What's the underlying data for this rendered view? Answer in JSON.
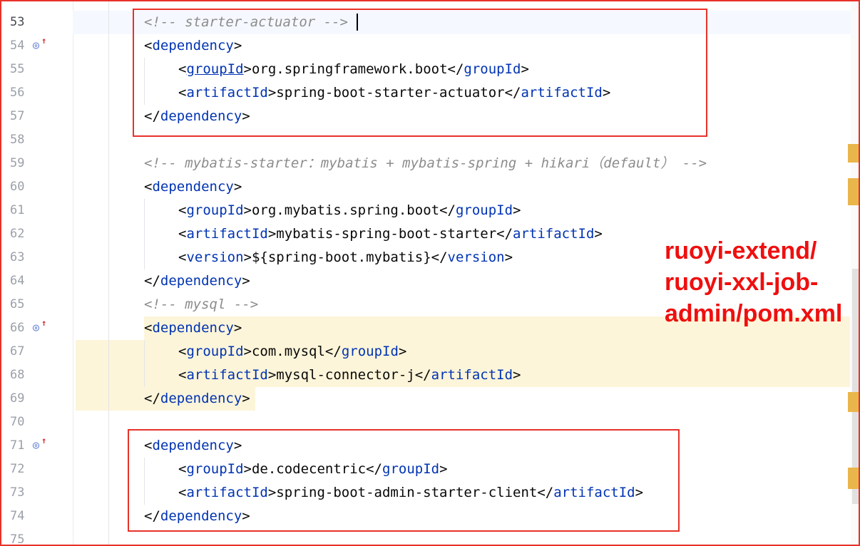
{
  "editor": {
    "file_annotation": "ruoyi-extend/\nruoyi-xxl-job-\nadmin/pom.xml",
    "lines": [
      {
        "num": "53",
        "tokens": [
          {
            "t": "<!-- starter-actuator -->",
            "c": "cm"
          }
        ]
      },
      {
        "num": "54",
        "tokens": [
          {
            "t": "<",
            "c": "p"
          },
          {
            "t": "dependency",
            "c": "tg"
          },
          {
            "t": ">",
            "c": "p"
          }
        ]
      },
      {
        "num": "55",
        "tokens": [
          {
            "t": "<",
            "c": "p"
          },
          {
            "t": "groupId",
            "c": "tg u"
          },
          {
            "t": ">org.springframework.boot</",
            "c": "p"
          },
          {
            "t": "groupId",
            "c": "tg"
          },
          {
            "t": ">",
            "c": "p"
          }
        ]
      },
      {
        "num": "56",
        "tokens": [
          {
            "t": "<",
            "c": "p"
          },
          {
            "t": "artifactId",
            "c": "tg"
          },
          {
            "t": ">spring-boot-starter-actuator</",
            "c": "p"
          },
          {
            "t": "artifactId",
            "c": "tg"
          },
          {
            "t": ">",
            "c": "p"
          }
        ]
      },
      {
        "num": "57",
        "tokens": [
          {
            "t": "</",
            "c": "p"
          },
          {
            "t": "dependency",
            "c": "tg"
          },
          {
            "t": ">",
            "c": "p"
          }
        ]
      },
      {
        "num": "58",
        "tokens": []
      },
      {
        "num": "59",
        "tokens": [
          {
            "t": "<!-- mybatis-starter：mybatis + mybatis-spring + hikari（default） -->",
            "c": "cm"
          }
        ]
      },
      {
        "num": "60",
        "tokens": [
          {
            "t": "<",
            "c": "p"
          },
          {
            "t": "dependency",
            "c": "tg"
          },
          {
            "t": ">",
            "c": "p"
          }
        ]
      },
      {
        "num": "61",
        "tokens": [
          {
            "t": "<",
            "c": "p"
          },
          {
            "t": "groupId",
            "c": "tg"
          },
          {
            "t": ">org.mybatis.spring.boot</",
            "c": "p"
          },
          {
            "t": "groupId",
            "c": "tg"
          },
          {
            "t": ">",
            "c": "p"
          }
        ]
      },
      {
        "num": "62",
        "tokens": [
          {
            "t": "<",
            "c": "p"
          },
          {
            "t": "artifactId",
            "c": "tg"
          },
          {
            "t": ">mybatis-spring-boot-starter</",
            "c": "p"
          },
          {
            "t": "artifactId",
            "c": "tg"
          },
          {
            "t": ">",
            "c": "p"
          }
        ]
      },
      {
        "num": "63",
        "tokens": [
          {
            "t": "<",
            "c": "p"
          },
          {
            "t": "version",
            "c": "tg"
          },
          {
            "t": ">${spring-boot.mybatis}</",
            "c": "p"
          },
          {
            "t": "version",
            "c": "tg"
          },
          {
            "t": ">",
            "c": "p"
          }
        ]
      },
      {
        "num": "64",
        "tokens": [
          {
            "t": "</",
            "c": "p"
          },
          {
            "t": "dependency",
            "c": "tg"
          },
          {
            "t": ">",
            "c": "p"
          }
        ]
      },
      {
        "num": "65",
        "tokens": [
          {
            "t": "<!-- mysql -->",
            "c": "cm"
          }
        ]
      },
      {
        "num": "66",
        "tokens": [
          {
            "t": "<",
            "c": "p"
          },
          {
            "t": "dependency",
            "c": "tg"
          },
          {
            "t": ">",
            "c": "p"
          }
        ]
      },
      {
        "num": "67",
        "tokens": [
          {
            "t": "<",
            "c": "p"
          },
          {
            "t": "groupId",
            "c": "tg"
          },
          {
            "t": ">com.mysql</",
            "c": "p"
          },
          {
            "t": "groupId",
            "c": "tg"
          },
          {
            "t": ">",
            "c": "p"
          }
        ]
      },
      {
        "num": "68",
        "tokens": [
          {
            "t": "<",
            "c": "p"
          },
          {
            "t": "artifactId",
            "c": "tg"
          },
          {
            "t": ">mysql-connector-j</",
            "c": "p"
          },
          {
            "t": "artifactId",
            "c": "tg"
          },
          {
            "t": ">",
            "c": "p"
          }
        ]
      },
      {
        "num": "69",
        "tokens": [
          {
            "t": "</",
            "c": "p"
          },
          {
            "t": "dependency",
            "c": "tg"
          },
          {
            "t": ">",
            "c": "p"
          }
        ]
      },
      {
        "num": "70",
        "tokens": []
      },
      {
        "num": "71",
        "tokens": [
          {
            "t": "<",
            "c": "p"
          },
          {
            "t": "dependency",
            "c": "tg"
          },
          {
            "t": ">",
            "c": "p"
          }
        ]
      },
      {
        "num": "72",
        "tokens": [
          {
            "t": "<",
            "c": "p"
          },
          {
            "t": "groupId",
            "c": "tg"
          },
          {
            "t": ">de.codecentric</",
            "c": "p"
          },
          {
            "t": "groupId",
            "c": "tg"
          },
          {
            "t": ">",
            "c": "p"
          }
        ]
      },
      {
        "num": "73",
        "tokens": [
          {
            "t": "<",
            "c": "p"
          },
          {
            "t": "artifactId",
            "c": "tg"
          },
          {
            "t": ">spring-boot-admin-starter-client</",
            "c": "p"
          },
          {
            "t": "artifactId",
            "c": "tg"
          },
          {
            "t": ">",
            "c": "p"
          }
        ]
      },
      {
        "num": "74",
        "tokens": [
          {
            "t": "</",
            "c": "p"
          },
          {
            "t": "dependency",
            "c": "tg"
          },
          {
            "t": ">",
            "c": "p"
          }
        ]
      },
      {
        "num": "75",
        "tokens": []
      }
    ],
    "gutter_icons": [
      {
        "line": "54",
        "icon": "implemented-target-icon"
      },
      {
        "line": "66",
        "icon": "implemented-target-icon"
      },
      {
        "line": "71",
        "icon": "implemented-target-icon"
      }
    ],
    "colors": {
      "tag": "#0033b3",
      "comment": "#8c8c8c",
      "annotation": "#ef0f0f",
      "highlight_box": "#e8322a",
      "line_highlight": "#fdf5d9"
    }
  }
}
